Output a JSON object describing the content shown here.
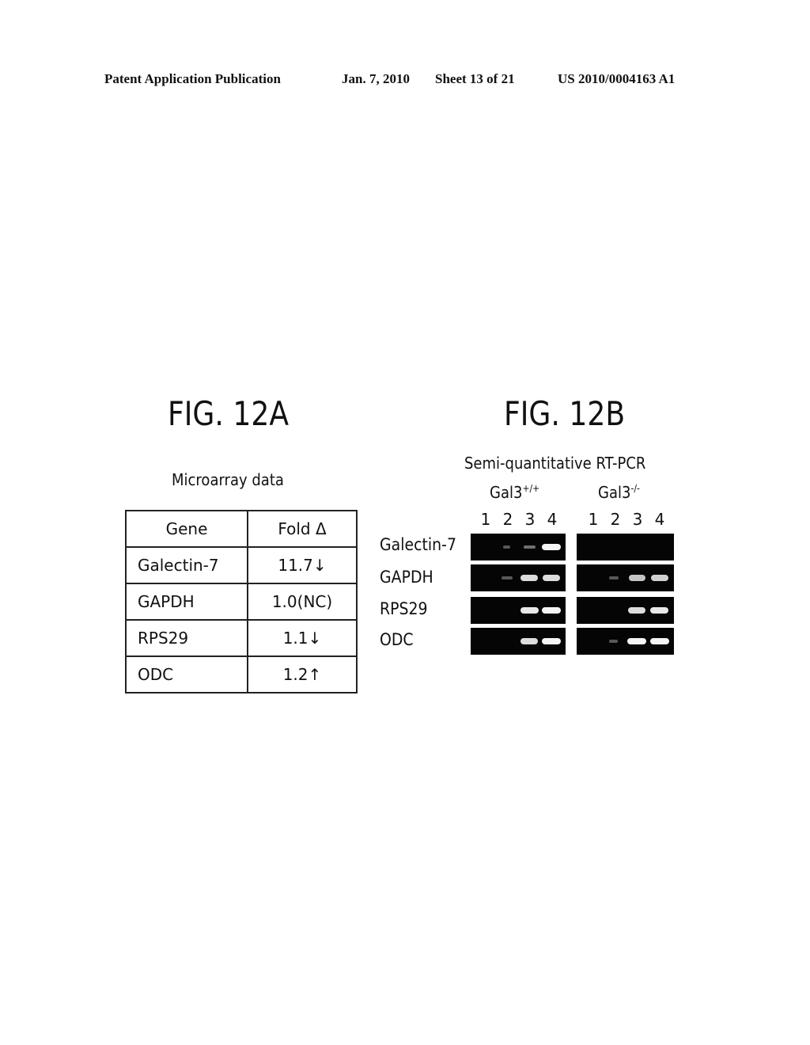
{
  "header": {
    "publication": "Patent Application Publication",
    "date": "Jan. 7, 2010",
    "sheet": "Sheet 13 of 21",
    "number": "US 2010/0004163 A1"
  },
  "fig_a": {
    "title": "FIG. 12A",
    "subtitle": "Microarray data",
    "table": {
      "headers": [
        "Gene",
        "Fold Δ"
      ],
      "rows": [
        {
          "gene": "Galectin-7",
          "fold": "11.7↓"
        },
        {
          "gene": "GAPDH",
          "fold": "1.0(NC)"
        },
        {
          "gene": "RPS29",
          "fold": "1.1↓"
        },
        {
          "gene": "ODC",
          "fold": "1.2↑"
        }
      ]
    }
  },
  "fig_b": {
    "title": "FIG. 12B",
    "subtitle": "Semi-quantitative RT-PCR",
    "groups": [
      {
        "name": "Gal3",
        "genotype": "+/+",
        "lanes": [
          "1",
          "2",
          "3",
          "4"
        ]
      },
      {
        "name": "Gal3",
        "genotype": "-/-",
        "lanes": [
          "1",
          "2",
          "3",
          "4"
        ]
      }
    ],
    "rows": [
      {
        "label": "Galectin-7",
        "wt_bands": [
          0,
          0.05,
          0.45,
          1.0
        ],
        "ko_bands": [
          0,
          0,
          0,
          0
        ]
      },
      {
        "label": "GAPDH",
        "wt_bands": [
          0,
          0.35,
          0.9,
          0.9
        ],
        "ko_bands": [
          0,
          0.25,
          0.8,
          0.85
        ]
      },
      {
        "label": "RPS29",
        "wt_bands": [
          0,
          0,
          0.95,
          1.0
        ],
        "ko_bands": [
          0,
          0,
          0.9,
          0.95
        ]
      },
      {
        "label": "ODC",
        "wt_bands": [
          0,
          0,
          0.9,
          1.0
        ],
        "ko_bands": [
          0,
          0.2,
          1.0,
          1.0
        ]
      }
    ]
  }
}
